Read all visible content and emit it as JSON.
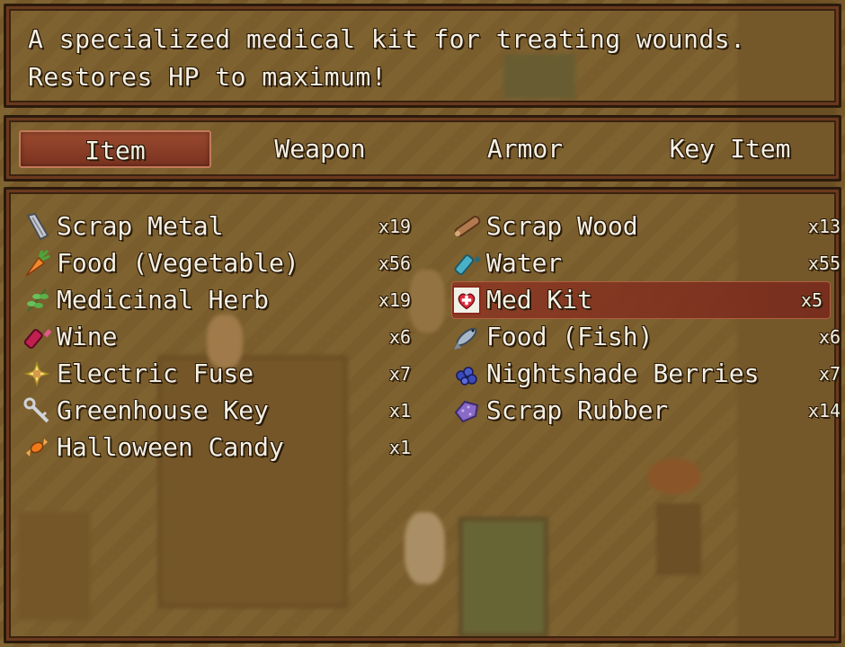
{
  "help": {
    "line1": "A specialized medical kit for treating wounds.",
    "line2": "Restores HP to maximum!"
  },
  "tabs": [
    {
      "label": "Item",
      "selected": true
    },
    {
      "label": "Weapon",
      "selected": false
    },
    {
      "label": "Armor",
      "selected": false
    },
    {
      "label": "Key Item",
      "selected": false
    }
  ],
  "items": [
    {
      "name": "Scrap Metal",
      "count": "x19",
      "icon": "scrap-metal-icon"
    },
    {
      "name": "Scrap Wood",
      "count": "x13",
      "icon": "scrap-wood-icon"
    },
    {
      "name": "Food (Vegetable)",
      "count": "x56",
      "icon": "carrot-icon"
    },
    {
      "name": "Water",
      "count": "x55",
      "icon": "water-bottle-icon"
    },
    {
      "name": "Medicinal Herb",
      "count": "x19",
      "icon": "herb-icon"
    },
    {
      "name": "Med Kit",
      "count": "x5",
      "icon": "med-kit-icon",
      "selected": true
    },
    {
      "name": "Wine",
      "count": "x6",
      "icon": "wine-bottle-icon"
    },
    {
      "name": "Food (Fish)",
      "count": "x6",
      "icon": "fish-icon"
    },
    {
      "name": "Electric Fuse",
      "count": "x7",
      "icon": "electric-fuse-icon"
    },
    {
      "name": "Nightshade Berries",
      "count": "x7",
      "icon": "berries-icon"
    },
    {
      "name": "Greenhouse Key",
      "count": "x1",
      "icon": "key-icon"
    },
    {
      "name": "Scrap Rubber",
      "count": "x14",
      "icon": "scrap-rubber-icon"
    },
    {
      "name": "Halloween Candy",
      "count": "x1",
      "icon": "candy-icon"
    }
  ],
  "colors": {
    "window_border": "#2b1a0c",
    "selection": "#8c3723",
    "text": "#f4f0e4"
  }
}
